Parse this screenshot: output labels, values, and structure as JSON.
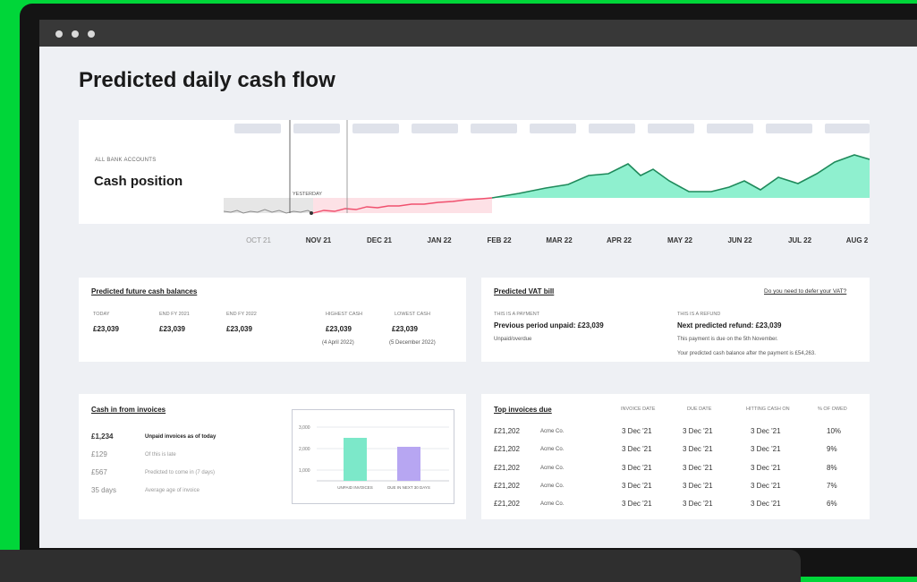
{
  "page": {
    "title": "Predicted daily cash flow"
  },
  "cash_card": {
    "caption": "ALL BANK ACCOUNTS",
    "title": "Cash position",
    "marker": "YESTERDAY"
  },
  "months": [
    "OCT 21",
    "NOV 21",
    "DEC 21",
    "JAN 22",
    "FEB 22",
    "MAR 22",
    "APR 22",
    "MAY 22",
    "JUN 22",
    "JUL 22",
    "AUG 2"
  ],
  "colors": {
    "past": "#8c8c8c",
    "negative": "#f0506e",
    "positive": "#1f8a5b",
    "positive_fill": "#8ff0cf",
    "unpaid": "#7ce8c9",
    "due": "#b7a6f2"
  },
  "balances": {
    "title": "Predicted future cash balances",
    "cols": [
      {
        "label": "TODAY",
        "value": "£23,039",
        "sub": ""
      },
      {
        "label": "END FY 2021",
        "value": "£23,039",
        "sub": ""
      },
      {
        "label": "END FY 2022",
        "value": "£23,039",
        "sub": ""
      },
      {
        "label": "HIGHEST CASH",
        "value": "£23,039",
        "sub": "(4 April 2022)"
      },
      {
        "label": "LOWEST CASH",
        "value": "£23,039",
        "sub": "(5 December 2022)"
      }
    ]
  },
  "vat": {
    "title": "Predicted VAT bill",
    "link": "Do you need to defer your VAT?",
    "left": {
      "label": "THIS IS A PAYMENT",
      "value": "Previous period unpaid: £23,039",
      "sub": "Unpaid/overdue"
    },
    "right": {
      "label": "THIS IS A REFUND",
      "value": "Next predicted refund: £23,039",
      "sub1": "This payment is due on the 5th November.",
      "sub2": "Your predicted cash balance after the payment is £54,263."
    }
  },
  "invoices_in": {
    "title": "Cash in from invoices",
    "rows": [
      {
        "value": "£1,234",
        "desc": "Unpaid invoices as of today"
      },
      {
        "value": "£129",
        "desc": "Of this is late"
      },
      {
        "value": "£567",
        "desc": "Predicted to come in (7 days)"
      },
      {
        "value": "35 days",
        "desc": "Average age of invoice"
      }
    ],
    "mini_chart": {
      "ticks": [
        "3,000",
        "2,000",
        "1,000"
      ],
      "bars": [
        {
          "label": "UNPAID INVOICES",
          "value": 2400
        },
        {
          "label": "DUE IN NEXT 30 DAYS",
          "value": 1900
        }
      ]
    }
  },
  "top_invoices": {
    "title": "Top invoices due",
    "headers": [
      "INVOICE DATE",
      "DUE DATE",
      "HITTING CASH ON",
      "% OF OWED"
    ],
    "rows": [
      {
        "amount": "£21,202",
        "client": "Acme Co.",
        "invoice_date": "3 Dec '21",
        "due_date": "3 Dec '21",
        "hitting": "3 Dec '21",
        "pct": "10%"
      },
      {
        "amount": "£21,202",
        "client": "Acme Co.",
        "invoice_date": "3 Dec '21",
        "due_date": "3 Dec '21",
        "hitting": "3 Dec '21",
        "pct": "9%"
      },
      {
        "amount": "£21,202",
        "client": "Acme Co.",
        "invoice_date": "3 Dec '21",
        "due_date": "3 Dec '21",
        "hitting": "3 Dec '21",
        "pct": "8%"
      },
      {
        "amount": "£21,202",
        "client": "Acme Co.",
        "invoice_date": "3 Dec '21",
        "due_date": "3 Dec '21",
        "hitting": "3 Dec '21",
        "pct": "7%"
      },
      {
        "amount": "£21,202",
        "client": "Acme Co.",
        "invoice_date": "3 Dec '21",
        "due_date": "3 Dec '21",
        "hitting": "3 Dec '21",
        "pct": "6%"
      }
    ]
  }
}
